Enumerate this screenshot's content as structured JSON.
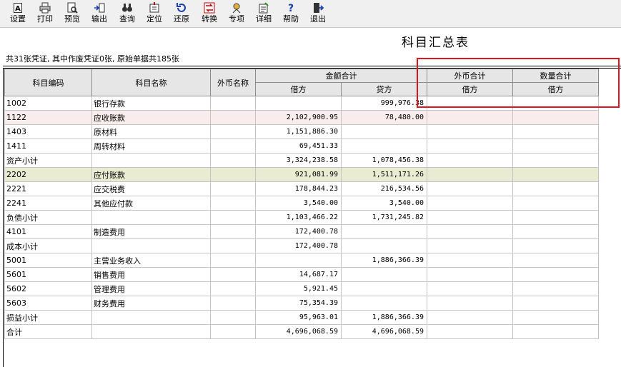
{
  "toolbar": {
    "buttons": [
      {
        "id": "settings",
        "label": "设置",
        "icon": "settings-icon"
      },
      {
        "id": "print",
        "label": "打印",
        "icon": "printer-icon"
      },
      {
        "id": "preview",
        "label": "预览",
        "icon": "preview-icon"
      },
      {
        "id": "export",
        "label": "输出",
        "icon": "export-icon"
      },
      {
        "id": "query",
        "label": "查询",
        "icon": "binoculars-icon"
      },
      {
        "id": "locate",
        "label": "定位",
        "icon": "locate-icon"
      },
      {
        "id": "restore",
        "label": "还原",
        "icon": "restore-icon"
      },
      {
        "id": "convert",
        "label": "转换",
        "icon": "convert-icon"
      },
      {
        "id": "special",
        "label": "专项",
        "icon": "special-icon"
      },
      {
        "id": "detail",
        "label": "详细",
        "icon": "detail-icon"
      },
      {
        "id": "help",
        "label": "帮助",
        "icon": "help-icon"
      },
      {
        "id": "exit",
        "label": "退出",
        "icon": "exit-icon"
      }
    ]
  },
  "report": {
    "title": "科目汇总表",
    "summary": "共31张凭证, 其中作废凭证0张, 原始单据共185张"
  },
  "table": {
    "headers": {
      "code": "科目编码",
      "name": "科目名称",
      "currency": "外币名称",
      "amount_total": "金额合计",
      "debit": "借方",
      "credit": "贷方",
      "fc_total": "外币合计",
      "fc_debit": "借方",
      "qty_total": "数量合计",
      "qty_debit": "借方"
    },
    "rows": [
      {
        "code": "1002",
        "name": "银行存款",
        "debit": "",
        "credit": "999,976.38",
        "style": ""
      },
      {
        "code": "1122",
        "name": "应收账款",
        "debit": "2,102,900.95",
        "credit": "78,480.00",
        "style": "hl"
      },
      {
        "code": "1403",
        "name": "原材料",
        "debit": "1,151,886.30",
        "credit": "",
        "style": ""
      },
      {
        "code": "1411",
        "name": "周转材料",
        "debit": "69,451.33",
        "credit": "",
        "style": ""
      },
      {
        "code": "资产小计",
        "name": "",
        "debit": "3,324,238.58",
        "credit": "1,078,456.38",
        "style": ""
      },
      {
        "code": "2202",
        "name": "应付账款",
        "debit": "921,081.99",
        "credit": "1,511,171.26",
        "style": "sel"
      },
      {
        "code": "2221",
        "name": "应交税费",
        "debit": "178,844.23",
        "credit": "216,534.56",
        "style": ""
      },
      {
        "code": "2241",
        "name": "其他应付款",
        "debit": "3,540.00",
        "credit": "3,540.00",
        "style": ""
      },
      {
        "code": "负债小计",
        "name": "",
        "debit": "1,103,466.22",
        "credit": "1,731,245.82",
        "style": ""
      },
      {
        "code": "4101",
        "name": "制造费用",
        "debit": "172,400.78",
        "credit": "",
        "style": ""
      },
      {
        "code": "成本小计",
        "name": "",
        "debit": "172,400.78",
        "credit": "",
        "style": ""
      },
      {
        "code": "5001",
        "name": "主营业务收入",
        "debit": "",
        "credit": "1,886,366.39",
        "style": ""
      },
      {
        "code": "5601",
        "name": "销售费用",
        "debit": "14,687.17",
        "credit": "",
        "style": ""
      },
      {
        "code": "5602",
        "name": "管理费用",
        "debit": "5,921.45",
        "credit": "",
        "style": ""
      },
      {
        "code": "5603",
        "name": "财务费用",
        "debit": "75,354.39",
        "credit": "",
        "style": ""
      },
      {
        "code": "损益小计",
        "name": "",
        "debit": "95,963.01",
        "credit": "1,886,366.39",
        "style": ""
      },
      {
        "code": "合计",
        "name": "",
        "debit": "4,696,068.59",
        "credit": "4,696,068.59",
        "style": ""
      }
    ]
  },
  "colors": {
    "highlight_box": "#e0141e",
    "selected_row": "#e9ecd2",
    "hover_row": "#f8ecec"
  }
}
